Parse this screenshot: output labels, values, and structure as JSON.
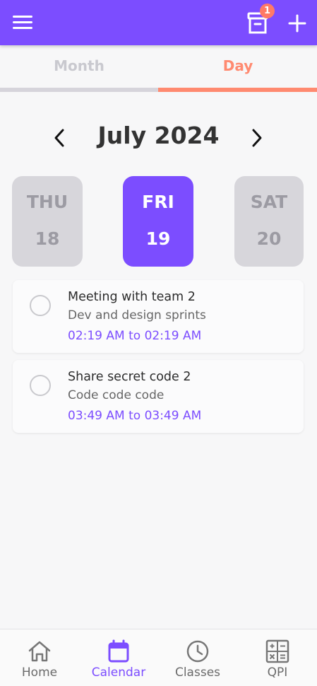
{
  "header": {
    "menu_icon": "hamburger-menu-icon",
    "archive_icon": "archive-box-icon",
    "badge_count": "1",
    "add_icon": "plus-icon",
    "accent_color": "#7c4dff"
  },
  "tabs": [
    {
      "label": "Month",
      "active": false
    },
    {
      "label": "Day",
      "active": true
    }
  ],
  "calendar": {
    "month_title": "July 2024",
    "days": [
      {
        "dow": "THU",
        "num": "18",
        "selected": false
      },
      {
        "dow": "FRI",
        "num": "19",
        "selected": true
      },
      {
        "dow": "SAT",
        "num": "20",
        "selected": false
      }
    ]
  },
  "events": [
    {
      "title": "Meeting with team 2",
      "subtitle": "Dev and design sprints",
      "time": "02:19 AM to 02:19 AM",
      "done": false
    },
    {
      "title": "Share secret code 2",
      "subtitle": "Code code code",
      "time": "03:49 AM to 03:49 AM",
      "done": false
    }
  ],
  "bottom_nav": [
    {
      "label": "Home",
      "icon": "home-icon",
      "active": false
    },
    {
      "label": "Calendar",
      "icon": "calendar-icon",
      "active": true
    },
    {
      "label": "Classes",
      "icon": "clock-icon",
      "active": false
    },
    {
      "label": "QPI",
      "icon": "calculator-icon",
      "active": false
    }
  ],
  "colors": {
    "primary": "#7c4dff",
    "tab_active": "#ff8a70",
    "badge": "#ff7a66"
  }
}
